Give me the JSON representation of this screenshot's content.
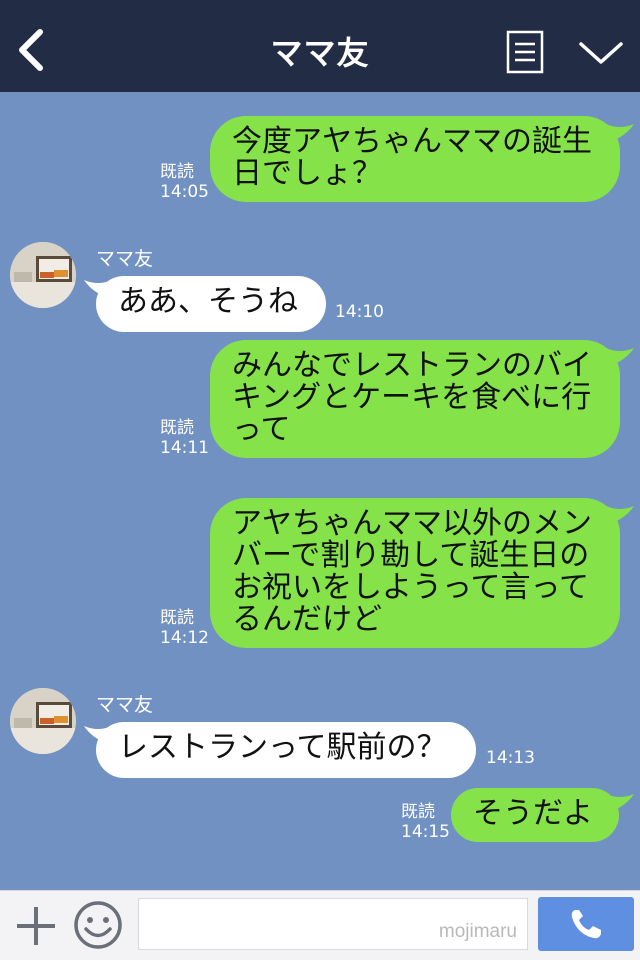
{
  "header": {
    "title": "ママ友",
    "back_icon": "chevron-left-icon",
    "memo_icon": "memo-icon",
    "menu_icon": "chevron-down-icon",
    "background": "#232c45"
  },
  "chat": {
    "background": "#7191c3",
    "outgoing_color": "#85e249",
    "incoming_color": "#ffffff",
    "messages": [
      {
        "direction": "out",
        "text": "今度アヤちゃんママの誕生\n日でしょ？",
        "read": "既読",
        "time": "14:05"
      },
      {
        "direction": "in",
        "sender": "ママ友",
        "text": "ああ、そうね",
        "time": "14:10"
      },
      {
        "direction": "out",
        "text": "みんなでレストランのバイ\nキングとケーキを食べに行\nって",
        "read": "既読",
        "time": "14:11"
      },
      {
        "direction": "out",
        "text": "アヤちゃんママ以外のメン\nバーで割り勘して誕生日の\nお祝いをしようって言って\nるんだけど",
        "read": "既読",
        "time": "14:12"
      },
      {
        "direction": "in",
        "sender": "ママ友",
        "text": "レストランって駅前の？",
        "time": "14:13"
      },
      {
        "direction": "out",
        "text": "そうだよ",
        "read": "既読",
        "time": "14:15"
      }
    ]
  },
  "composer": {
    "plus_icon": "plus-icon",
    "emoji_icon": "smile-icon",
    "placeholder": "",
    "watermark": "mojimaru",
    "call_icon": "phone-icon",
    "call_color": "#5f8fe0"
  }
}
